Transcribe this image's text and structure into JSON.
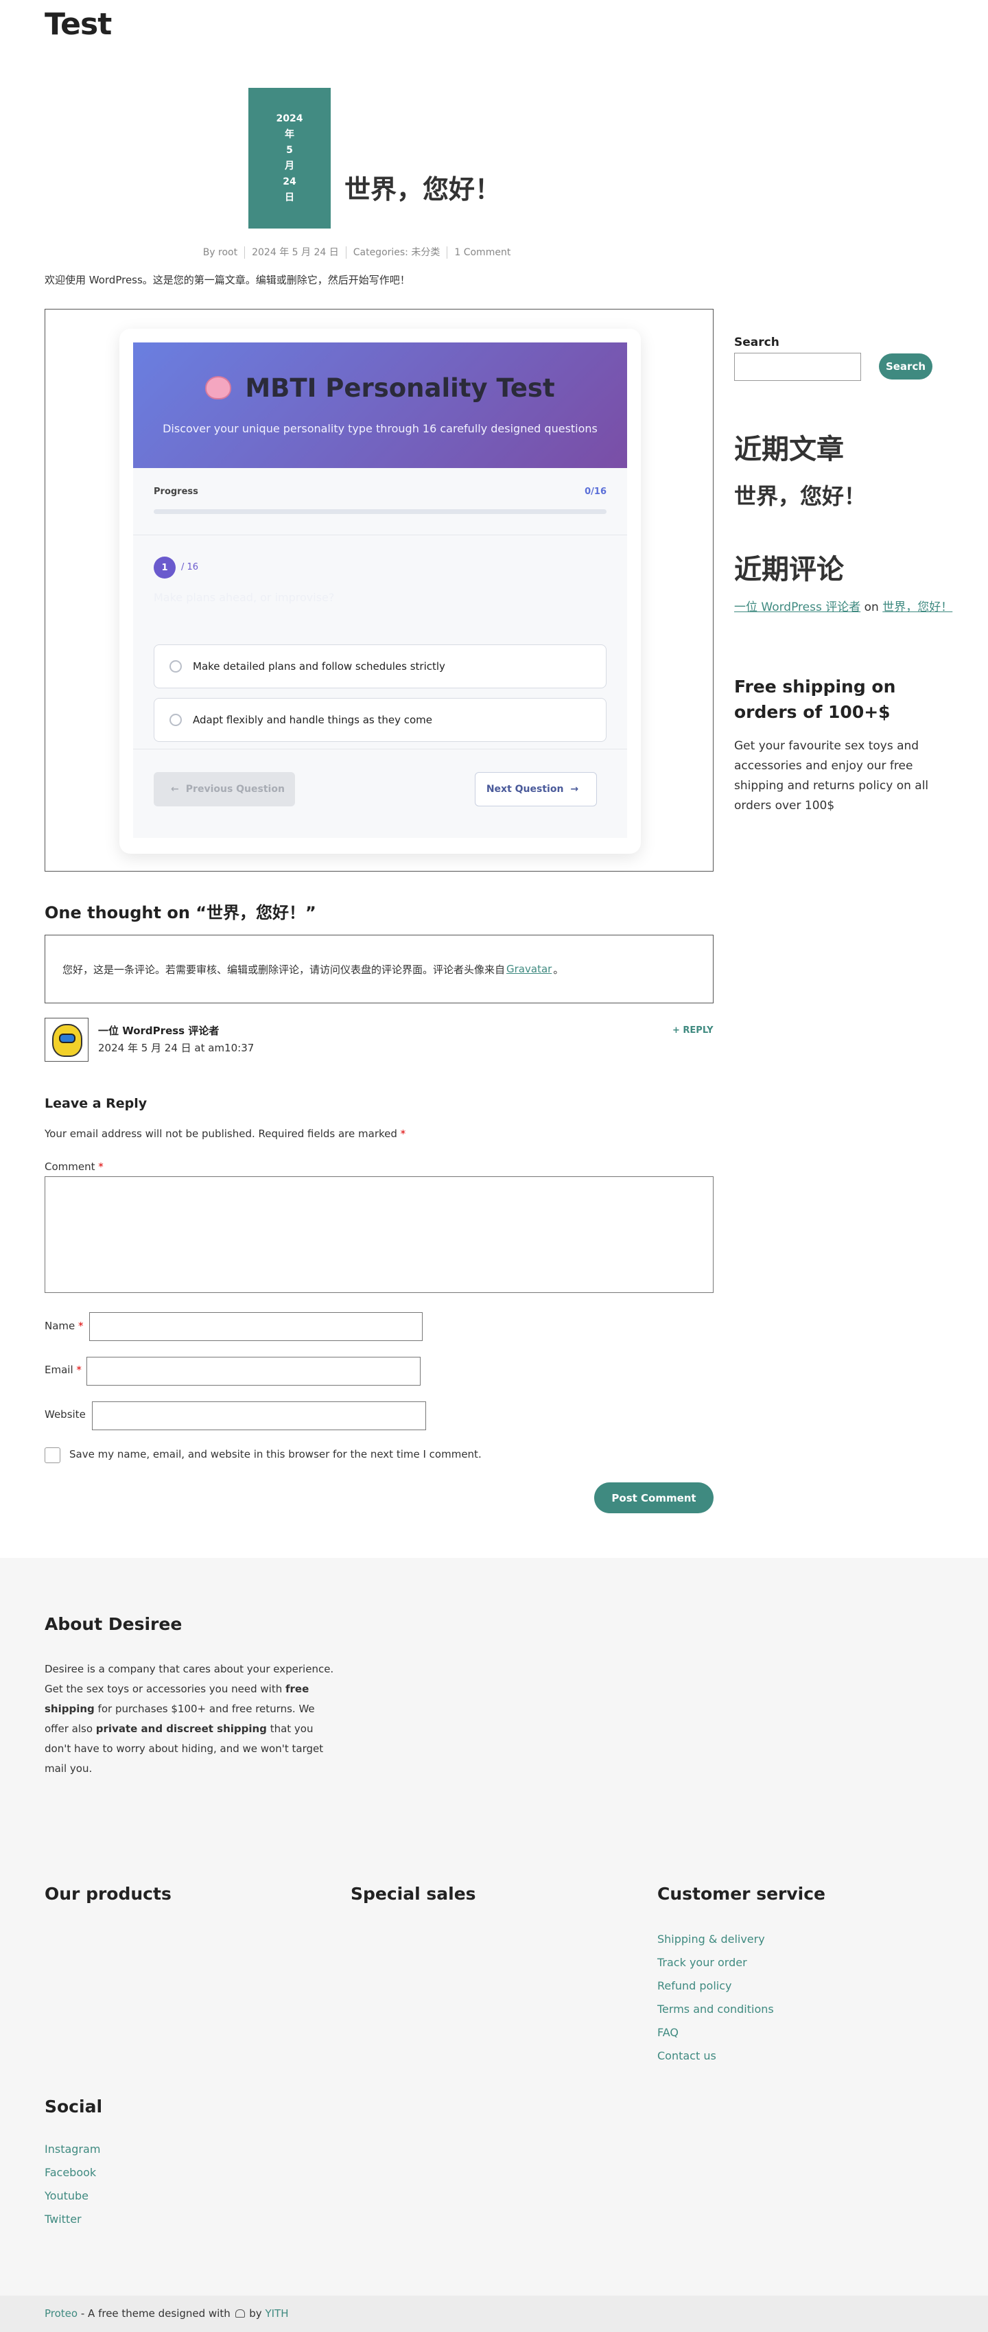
{
  "site": {
    "title": "Test"
  },
  "post": {
    "date_lines": [
      "2024",
      "年",
      "5",
      "月",
      "24",
      "日"
    ],
    "title": "世界，您好！",
    "meta": {
      "author": "By root",
      "date": "2024 年 5 月 24 日",
      "categories": "Categories: 未分类",
      "comments": "1 Comment"
    },
    "intro": "欢迎使用 WordPress。这是您的第一篇文章。编辑或删除它，然后开始写作吧！"
  },
  "quiz": {
    "title": "MBTI Personality Test",
    "subtitle": "Discover your unique personality type through 16 carefully designed questions",
    "progress_label": "Progress",
    "progress_count": "0/16",
    "progress_fraction": 0,
    "question_number": "1",
    "question_total": "/ 16",
    "question_faint": "Make plans ahead, or improvise?",
    "options": [
      "Make detailed plans and follow schedules strictly",
      "Adapt flexibly and handle things as they come"
    ],
    "prev_label": "Previous Question",
    "next_label": "Next Question",
    "colors": {
      "header_start": "#6a7fe0",
      "header_end": "#7a4ea6",
      "accent": "#6a5acd"
    }
  },
  "comments": {
    "heading": "One thought on “世界，您好！”",
    "first_comment": {
      "text_before": "您好，这是一条评论。若需要审核、编辑或删除评论，请访问仪表盘的评论界面。评论者头像来自",
      "link": "Gravatar",
      "text_after": "。"
    },
    "author": "一位 WordPress 评论者",
    "date": "2024 年 5 月 24 日 at am10:37",
    "reply": "+ REPLY",
    "avatar_icon": "avatar-icon"
  },
  "reply_form": {
    "heading": "Leave a Reply",
    "notes": "Your email address will not be published. Required fields are marked",
    "required_mark": "*",
    "comment_label": "Comment",
    "name_label": "Name",
    "email_label": "Email",
    "website_label": "Website",
    "remember": "Save my name, email, and website in this browser for the next time I comment.",
    "submit": "Post Comment"
  },
  "sidebar": {
    "search_label": "Search",
    "search_button": "Search",
    "recent_posts_title": "近期文章",
    "recent_post": "世界，您好！",
    "recent_comments_title": "近期评论",
    "recent_comment": {
      "author": "一位 WordPress 评论者",
      "on": "on",
      "post": "世界，您好！"
    },
    "shipping_title": "Free shipping on orders of 100+$",
    "shipping_text": "Get your favourite sex toys and accessories and enjoy our free shipping and returns policy on all orders over 100$"
  },
  "footer": {
    "about_title": "About Desiree",
    "about_text": {
      "p1": "Desiree is a company that cares about your experience. Get the sex toys or accessories you need with ",
      "b1": "free shipping",
      "p2": " for purchases $100+ and free returns.  We offer also ",
      "b2": "private and discreet shipping",
      "p3": " that you don't have to worry about hiding, and we won't target mail you."
    },
    "our_products": "Our products",
    "special_sales": "Special sales",
    "customer_service": "Customer service",
    "cs_links": [
      "Shipping & delivery",
      "Track your order",
      "Refund policy",
      "Terms and conditions",
      "FAQ",
      "Contact us"
    ],
    "social_title": "Social",
    "social_links": [
      "Instagram",
      "Facebook",
      "Youtube",
      "Twitter"
    ],
    "credits": {
      "theme": "Proteo",
      "middle": " - A free theme designed with ",
      "by": " by ",
      "author": "YITH"
    },
    "colors": {
      "accent": "#3f8a80",
      "background": "#f6f6f6"
    }
  }
}
